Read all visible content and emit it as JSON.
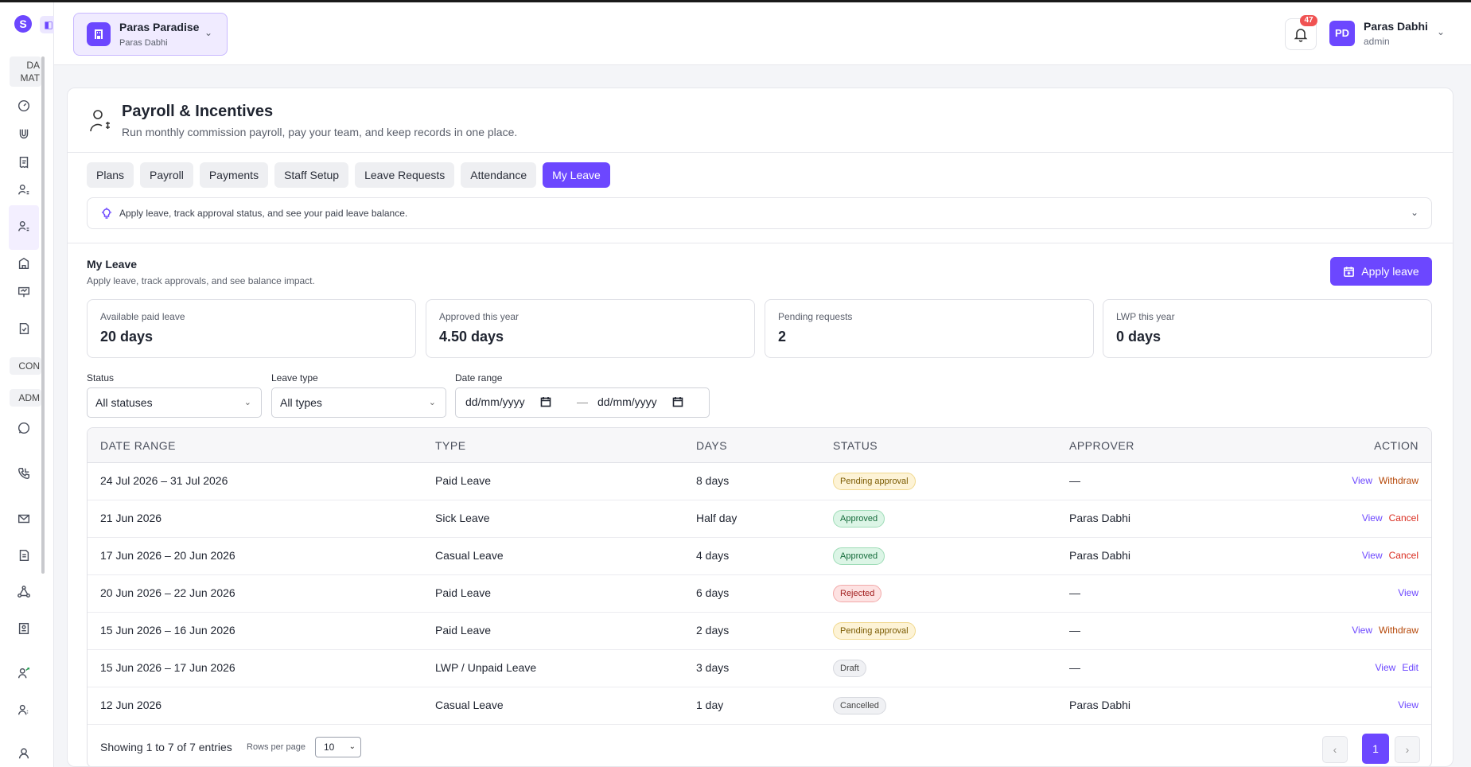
{
  "sidebar": {
    "logo": "S",
    "sections": [
      "DA MAT",
      "CON",
      "ADM"
    ]
  },
  "header": {
    "org_name": "Paras Paradise",
    "org_sub": "Paras Dabhi",
    "notif_count": "47",
    "avatar_initials": "PD",
    "user_name": "Paras Dabhi",
    "user_role": "admin"
  },
  "page": {
    "title": "Payroll & Incentives",
    "subtitle": "Run monthly commission payroll, pay your team, and keep records in one place.",
    "tabs": [
      "Plans",
      "Payroll",
      "Payments",
      "Staff Setup",
      "Leave Requests",
      "Attendance",
      "My Leave"
    ],
    "active_tab": "My Leave",
    "hint": "Apply leave, track approval status, and see your paid leave balance."
  },
  "my_leave": {
    "title": "My Leave",
    "subtitle": "Apply leave, track approvals, and see balance impact.",
    "apply_label": "Apply leave",
    "stats": [
      {
        "label": "Available paid leave",
        "value": "20 days"
      },
      {
        "label": "Approved this year",
        "value": "4.50 days"
      },
      {
        "label": "Pending requests",
        "value": "2"
      },
      {
        "label": "LWP this year",
        "value": "0 days"
      }
    ]
  },
  "filters": {
    "status_label": "Status",
    "status_value": "All statuses",
    "type_label": "Leave type",
    "type_value": "All types",
    "date_label": "Date range",
    "date_from": "dd/mm/yyyy",
    "date_sep": "—",
    "date_to": "dd/mm/yyyy"
  },
  "table": {
    "headers": [
      "DATE RANGE",
      "TYPE",
      "DAYS",
      "STATUS",
      "APPROVER",
      "ACTION"
    ],
    "rows": [
      {
        "date": "24 Jul 2026 – 31 Jul 2026",
        "type": "Paid Leave",
        "days": "8 days",
        "status": "Pending approval",
        "approver": "—",
        "actions": [
          "View",
          "Withdraw"
        ]
      },
      {
        "date": "21 Jun 2026",
        "type": "Sick Leave",
        "days": "Half day",
        "status": "Approved",
        "approver": "Paras Dabhi",
        "actions": [
          "View",
          "Cancel"
        ]
      },
      {
        "date": "17 Jun 2026 – 20 Jun 2026",
        "type": "Casual Leave",
        "days": "4 days",
        "status": "Approved",
        "approver": "Paras Dabhi",
        "actions": [
          "View",
          "Cancel"
        ]
      },
      {
        "date": "20 Jun 2026 – 22 Jun 2026",
        "type": "Paid Leave",
        "days": "6 days",
        "status": "Rejected",
        "approver": "—",
        "actions": [
          "View"
        ]
      },
      {
        "date": "15 Jun 2026 – 16 Jun 2026",
        "type": "Paid Leave",
        "days": "2 days",
        "status": "Pending approval",
        "approver": "—",
        "actions": [
          "View",
          "Withdraw"
        ]
      },
      {
        "date": "15 Jun 2026 – 17 Jun 2026",
        "type": "LWP / Unpaid Leave",
        "days": "3 days",
        "status": "Draft",
        "approver": "—",
        "actions": [
          "View",
          "Edit"
        ]
      },
      {
        "date": "12 Jun 2026",
        "type": "Casual Leave",
        "days": "1 day",
        "status": "Cancelled",
        "approver": "Paras Dabhi",
        "actions": [
          "View"
        ]
      }
    ],
    "showing": "Showing 1 to 7 of 7 entries",
    "rows_per_page_label": "Rows per page",
    "rows_per_page": "10",
    "current_page": "1",
    "prev_icon": "‹",
    "next_icon": "›"
  },
  "colors": {
    "accent": "#6c47ff",
    "badge": "#f05252"
  }
}
